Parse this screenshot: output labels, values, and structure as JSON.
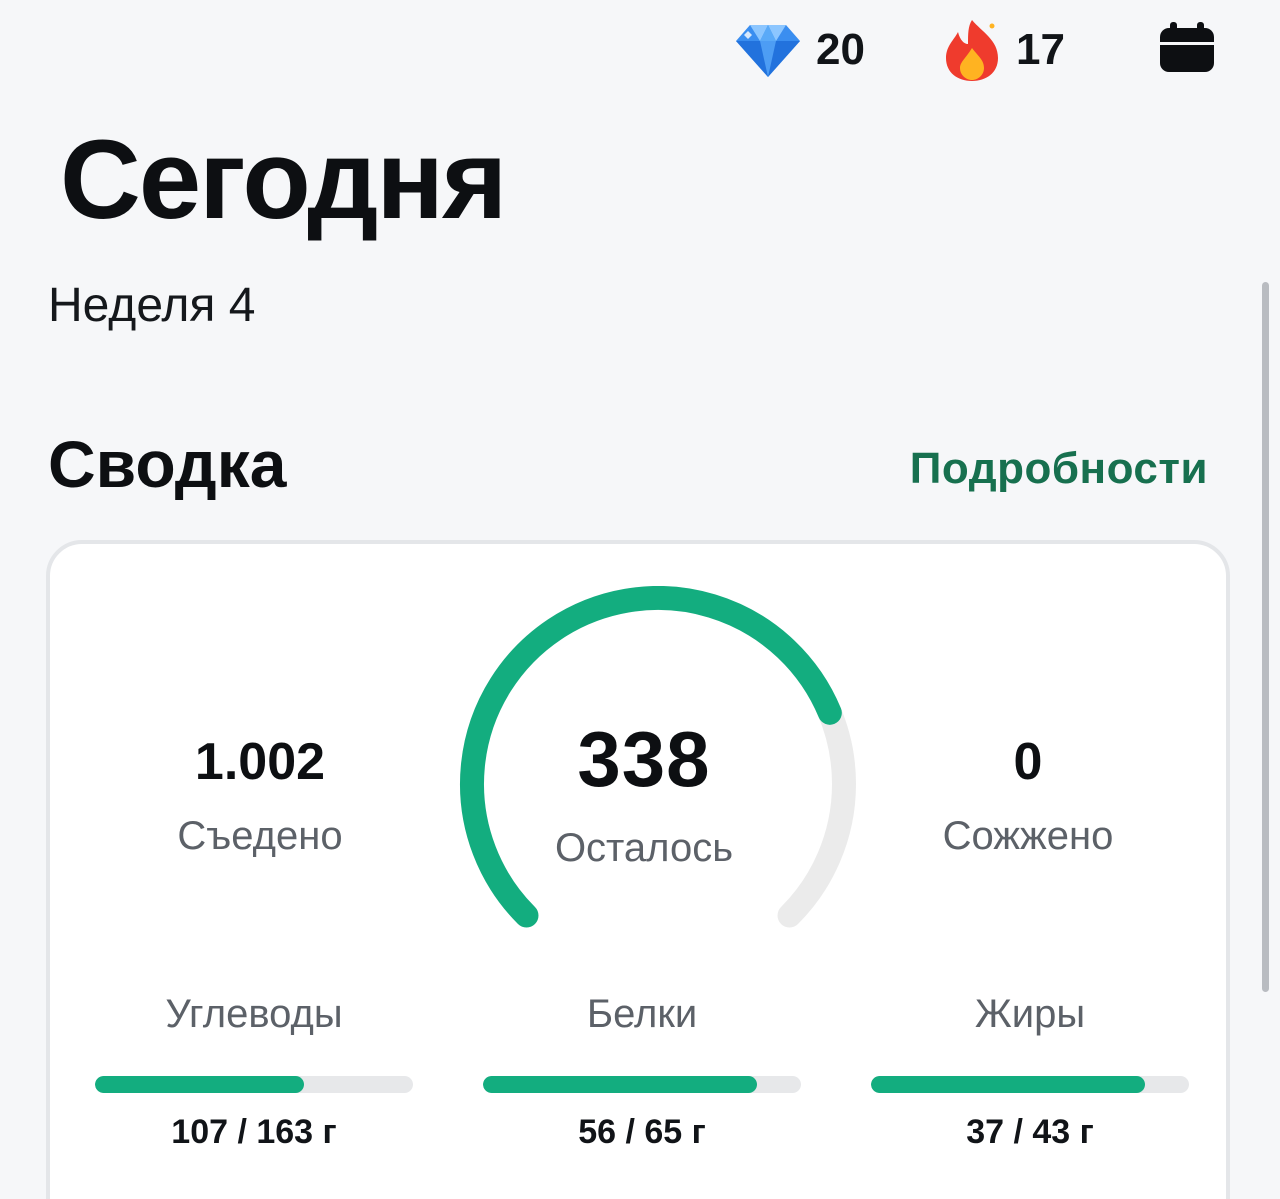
{
  "header": {
    "gems": {
      "icon": "diamond-icon",
      "value": "20"
    },
    "streak": {
      "icon": "fire-icon",
      "value": "17"
    },
    "calendar_icon": "calendar-icon"
  },
  "page": {
    "title": "Сегодня",
    "week": "Неделя 4"
  },
  "summary": {
    "title": "Сводка",
    "details_link": "Подробности",
    "eaten": {
      "value": "1.002",
      "label": "Съедено"
    },
    "remaining": {
      "value": "338",
      "label": "Осталось",
      "progress": 0.75
    },
    "burned": {
      "value": "0",
      "label": "Сожжено"
    },
    "macros": [
      {
        "name": "Углеводы",
        "amount": "107 / 163 г",
        "consumed": 107,
        "target": 163
      },
      {
        "name": "Белки",
        "amount": "56 / 65 г",
        "consumed": 56,
        "target": 65
      },
      {
        "name": "Жиры",
        "amount": "37 / 43 г",
        "consumed": 37,
        "target": 43
      }
    ]
  },
  "colors": {
    "accent": "#13ad7f",
    "link": "#17704f",
    "track": "#ebebeb"
  }
}
